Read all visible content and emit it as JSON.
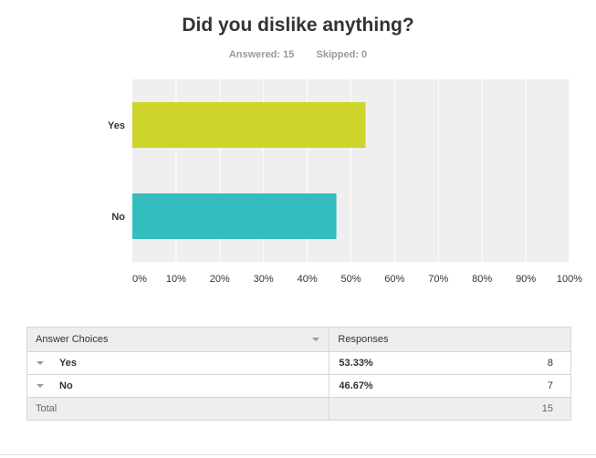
{
  "question": {
    "title": "Did you dislike anything?",
    "answered_label": "Answered:",
    "answered_count": "15",
    "skipped_label": "Skipped:",
    "skipped_count": "0"
  },
  "chart_data": {
    "type": "bar",
    "orientation": "horizontal",
    "title": "Did you dislike anything?",
    "categories": [
      "Yes",
      "No"
    ],
    "values": [
      53.33,
      46.67
    ],
    "colors": [
      "#cdd42a",
      "#33bdbf"
    ],
    "xlim": [
      0,
      100
    ],
    "x_ticks": [
      "0%",
      "10%",
      "20%",
      "30%",
      "40%",
      "50%",
      "60%",
      "70%",
      "80%",
      "90%",
      "100%"
    ],
    "grid": true,
    "background": "#efefef"
  },
  "table": {
    "headers": [
      "Answer Choices",
      "Responses"
    ],
    "rows": [
      {
        "choice": "Yes",
        "percent": "53.33%",
        "count": "8"
      },
      {
        "choice": "No",
        "percent": "46.67%",
        "count": "7"
      }
    ],
    "total_label": "Total",
    "total_count": "15"
  }
}
